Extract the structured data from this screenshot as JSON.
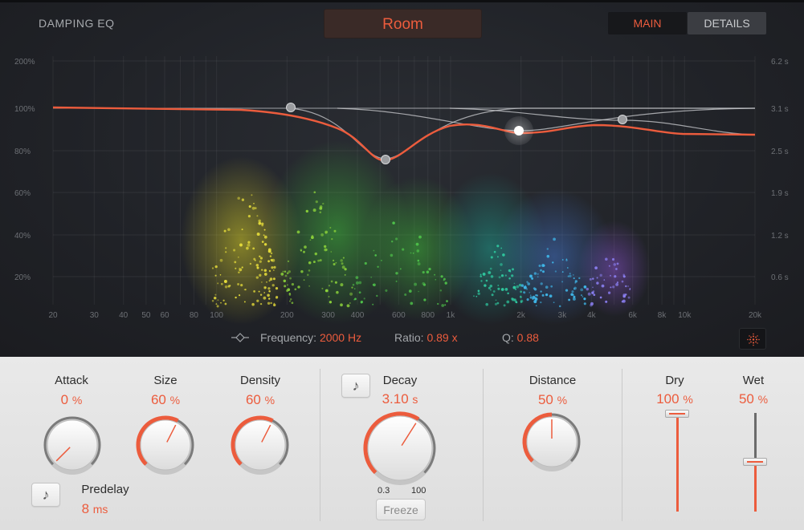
{
  "eq": {
    "title": "DAMPING EQ",
    "preset": "Room",
    "tabs": {
      "main": "MAIN",
      "details": "DETAILS"
    },
    "y_left_labels": [
      "200%",
      "100%",
      "80%",
      "60%",
      "40%",
      "20%"
    ],
    "y_right_labels": [
      "6.2 s",
      "3.1 s",
      "2.5 s",
      "1.9 s",
      "1.2 s",
      "0.6 s"
    ],
    "x_labels": [
      "20",
      "30",
      "40",
      "50",
      "60",
      "80",
      "100",
      "200",
      "300",
      "400",
      "600",
      "800",
      "1k",
      "2k",
      "3k",
      "4k",
      "6k",
      "8k",
      "10k",
      "20k"
    ],
    "status": {
      "frequency_label": "Frequency:",
      "frequency_value": "2000 Hz",
      "ratio_label": "Ratio:",
      "ratio_value": "0.89 x",
      "q_label": "Q:",
      "q_value": "0.88"
    }
  },
  "controls": {
    "attack": {
      "label": "Attack",
      "value": "0",
      "unit": "%",
      "level": 0.0
    },
    "size": {
      "label": "Size",
      "value": "60",
      "unit": "%",
      "level": 0.6
    },
    "density": {
      "label": "Density",
      "value": "60",
      "unit": "%",
      "level": 0.6
    },
    "predelay": {
      "label": "Predelay",
      "value": "8",
      "unit": "ms"
    },
    "decay": {
      "label": "Decay",
      "value": "3.10",
      "unit": "s",
      "level": 0.62,
      "min_label": "0.3",
      "max_label": "100",
      "freeze_label": "Freeze"
    },
    "distance": {
      "label": "Distance",
      "value": "50",
      "unit": "%",
      "level": 0.5
    },
    "dry": {
      "label": "Dry",
      "value": "100",
      "unit": "%",
      "level": 1.0
    },
    "wet": {
      "label": "Wet",
      "value": "50",
      "unit": "%",
      "level": 0.5
    }
  },
  "icons": {
    "note": "♪"
  },
  "colors": {
    "accent": "#ec5c3d",
    "panel_dark": "#202227",
    "panel_light": "#e4e4e4"
  }
}
